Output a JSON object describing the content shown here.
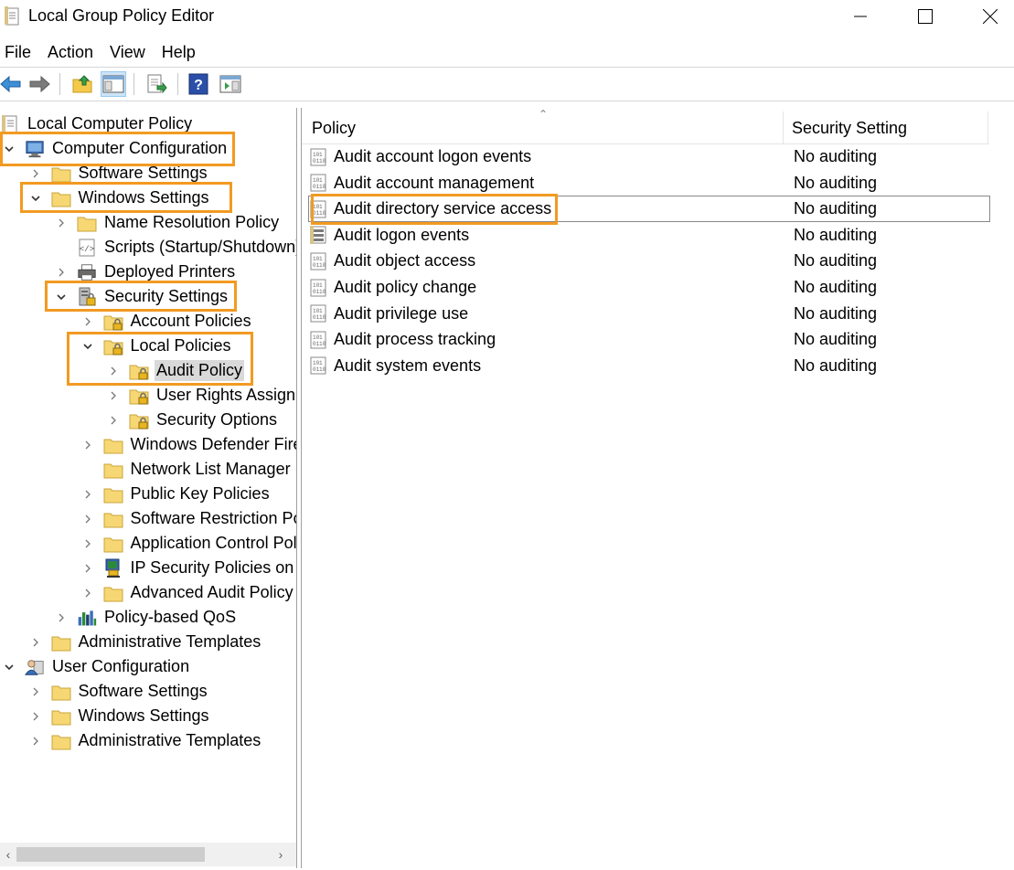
{
  "window": {
    "title": "Local Group Policy Editor"
  },
  "menu": [
    "File",
    "Action",
    "View",
    "Help"
  ],
  "toolbar": {
    "icons": [
      "back-arrow-icon",
      "forward-arrow-icon",
      "up-folder-icon",
      "show-hide-tree-icon",
      "export-list-icon",
      "help-icon",
      "properties-pane-icon"
    ]
  },
  "tree": {
    "items": [
      {
        "label": "Local Computer Policy",
        "icon": "policy-doc-icon"
      },
      {
        "label": "Computer Configuration",
        "icon": "computer-icon"
      },
      {
        "label": "Software Settings",
        "icon": "folder-icon"
      },
      {
        "label": "Windows Settings",
        "icon": "folder-icon"
      },
      {
        "label": "Name Resolution Policy",
        "icon": "folder-icon"
      },
      {
        "label": "Scripts (Startup/Shutdown)",
        "icon": "script-icon"
      },
      {
        "label": "Deployed Printers",
        "icon": "printer-icon"
      },
      {
        "label": "Security Settings",
        "icon": "security-settings-icon"
      },
      {
        "label": "Account Policies",
        "icon": "locked-folder-icon"
      },
      {
        "label": "Local Policies",
        "icon": "locked-folder-icon"
      },
      {
        "label": "Audit Policy",
        "icon": "locked-folder-icon"
      },
      {
        "label": "User Rights Assignment",
        "icon": "locked-folder-icon"
      },
      {
        "label": "Security Options",
        "icon": "locked-folder-icon"
      },
      {
        "label": "Windows Defender Firewall with Advanced Security",
        "icon": "folder-icon"
      },
      {
        "label": "Network List Manager Policies",
        "icon": "folder-icon"
      },
      {
        "label": "Public Key Policies",
        "icon": "folder-icon"
      },
      {
        "label": "Software Restriction Policies",
        "icon": "folder-icon"
      },
      {
        "label": "Application Control Policies",
        "icon": "folder-icon"
      },
      {
        "label": "IP Security Policies on Local Computer",
        "icon": "ip-security-icon"
      },
      {
        "label": "Advanced Audit Policy Configuration",
        "icon": "folder-icon"
      },
      {
        "label": "Policy-based QoS",
        "icon": "qos-chart-icon"
      },
      {
        "label": "Administrative Templates",
        "icon": "folder-icon"
      },
      {
        "label": "User Configuration",
        "icon": "user-icon"
      },
      {
        "label": "Software Settings",
        "icon": "folder-icon"
      },
      {
        "label": "Windows Settings",
        "icon": "folder-icon"
      },
      {
        "label": "Administrative Templates",
        "icon": "folder-icon"
      }
    ]
  },
  "list": {
    "columns": [
      "Policy",
      "Security Setting"
    ],
    "rows": [
      {
        "policy": "Audit account logon events",
        "setting": "No auditing"
      },
      {
        "policy": "Audit account management",
        "setting": "No auditing"
      },
      {
        "policy": "Audit directory service access",
        "setting": "No auditing"
      },
      {
        "policy": "Audit logon events",
        "setting": "No auditing"
      },
      {
        "policy": "Audit object access",
        "setting": "No auditing"
      },
      {
        "policy": "Audit policy change",
        "setting": "No auditing"
      },
      {
        "policy": "Audit privilege use",
        "setting": "No auditing"
      },
      {
        "policy": "Audit process tracking",
        "setting": "No auditing"
      },
      {
        "policy": "Audit system events",
        "setting": "No auditing"
      }
    ]
  },
  "colors": {
    "highlight": "#f29a22",
    "selection": "#d9d9d9",
    "folder": "#f7d774"
  }
}
